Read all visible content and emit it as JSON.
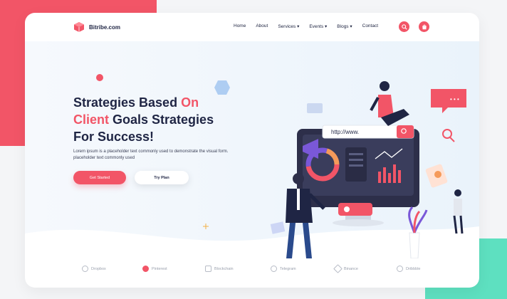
{
  "brand": {
    "name": "Bitribe.com"
  },
  "nav": {
    "items": [
      {
        "label": "Home"
      },
      {
        "label": "About"
      },
      {
        "label": "Services ▾"
      },
      {
        "label": "Events ▾"
      },
      {
        "label": "Blogs ▾"
      },
      {
        "label": "Contact"
      }
    ],
    "search_icon": "search-icon",
    "cart_icon": "cart-icon",
    "cart_count": "0"
  },
  "hero": {
    "title_line1_a": "Strategies Based ",
    "title_line1_b": "On",
    "title_line2_a": "Client",
    "title_line2_b": " Goals Strategies",
    "title_line3": "For Success!",
    "description": "Lorem ipsum is a placeholder text commonly used to demonstrate the visual form. placeholder text commonly used",
    "primary_button": "Get Started",
    "secondary_button": "Try Plan"
  },
  "illustration": {
    "url_text": "http://www.",
    "chat_dots": "• • •"
  },
  "partners": [
    {
      "name": "Dropbox",
      "icon": "dropbox-icon"
    },
    {
      "name": "Pinterest",
      "icon": "pinterest-icon"
    },
    {
      "name": "Blockchain",
      "icon": "blockchain-icon"
    },
    {
      "name": "Telegram",
      "icon": "telegram-icon"
    },
    {
      "name": "Binance",
      "icon": "binance-icon"
    },
    {
      "name": "Dribbble",
      "icon": "dribbble-icon"
    }
  ],
  "colors": {
    "accent": "#f25567",
    "dark": "#1f2544",
    "teal": "#5ee0c0"
  }
}
